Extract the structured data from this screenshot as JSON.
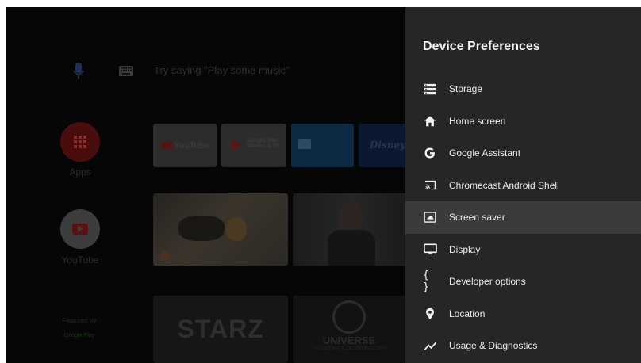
{
  "launcher": {
    "search_hint": "Try saying \"Play some music\"",
    "apps_label": "Apps",
    "youtube_label": "YouTube",
    "featured_label": "Featured by",
    "featured_source": "Google Play",
    "app_row": [
      "YouTube",
      "Google Play Movies & TV",
      "",
      "Disney+"
    ],
    "channel_row": [
      "STARZ",
      "UNIVERSE",
      "THE ULTIMATE DC MEMBERSHIP"
    ]
  },
  "panel": {
    "title": "Device Preferences",
    "items": [
      {
        "label": "Storage",
        "icon": "storage-icon",
        "focused": false
      },
      {
        "label": "Home screen",
        "icon": "home-icon",
        "focused": false
      },
      {
        "label": "Google Assistant",
        "icon": "google-icon",
        "focused": false
      },
      {
        "label": "Chromecast Android Shell",
        "icon": "cast-icon",
        "focused": false
      },
      {
        "label": "Screen saver",
        "icon": "screen-saver-icon",
        "focused": true
      },
      {
        "label": "Display",
        "icon": "display-icon",
        "focused": false
      },
      {
        "label": "Developer options",
        "icon": "braces-icon",
        "focused": false
      },
      {
        "label": "Location",
        "icon": "location-pin-icon",
        "focused": false
      },
      {
        "label": "Usage & Diagnostics",
        "icon": "chart-line-icon",
        "focused": false
      }
    ]
  },
  "colors": {
    "panel_bg": "#262626",
    "focused_row": "#3b3b3b",
    "apps_circle": "#4a0d0d",
    "youtube_circle": "#3d3d3d"
  }
}
